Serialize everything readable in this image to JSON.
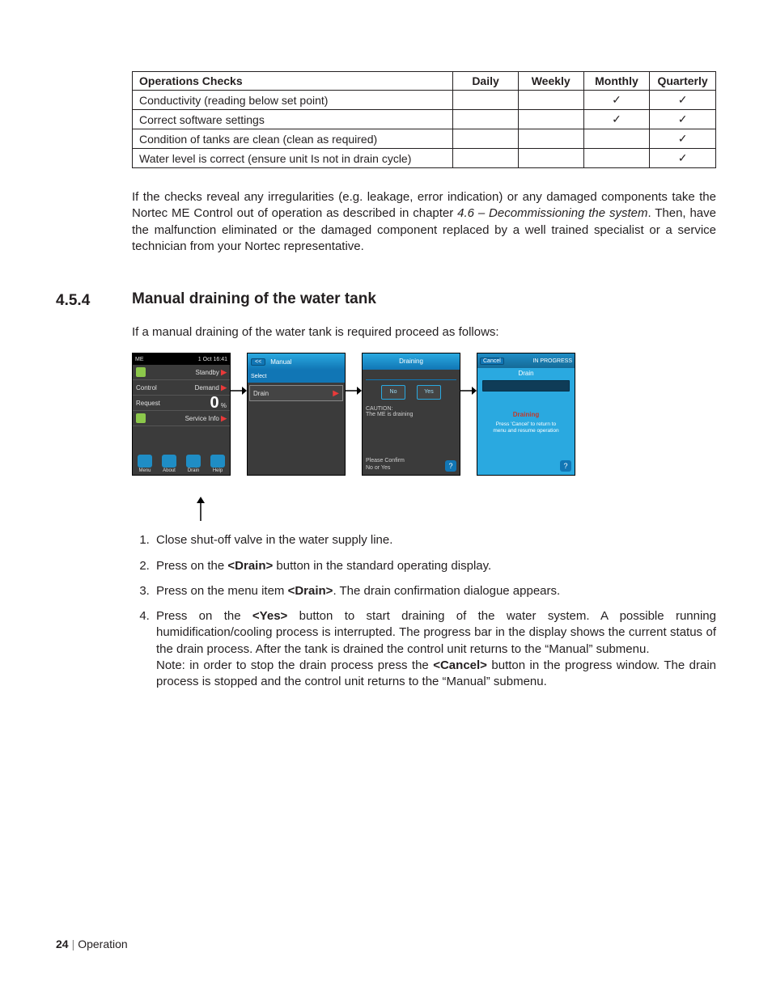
{
  "checks_table": {
    "headers": [
      "Operations Checks",
      "Daily",
      "Weekly",
      "Monthly",
      "Quarterly"
    ],
    "tick": "✓",
    "rows": [
      {
        "label": "Conductivity (reading below set point)",
        "daily": "",
        "weekly": "",
        "monthly": "tick",
        "quarterly": "tick"
      },
      {
        "label": "Correct software settings",
        "daily": "",
        "weekly": "",
        "monthly": "tick",
        "quarterly": "tick"
      },
      {
        "label": "Condition of tanks are clean (clean as required)",
        "daily": "",
        "weekly": "",
        "monthly": "",
        "quarterly": "tick"
      },
      {
        "label": "Water level is correct (ensure unit Is not in drain cycle)",
        "daily": "",
        "weekly": "",
        "monthly": "",
        "quarterly": "tick"
      }
    ]
  },
  "para_after_table": {
    "t1": "If the checks reveal any irregularities (e.g. leakage, error indication) or any damaged components take the Nortec ME Control out of operation as described in chapter ",
    "ref": "4.6 – Decommissioning the system",
    "t2": ". Then, have the malfunction eliminated or the damaged component replaced by a well trained specialist or a service technician from your Nortec representative."
  },
  "section": {
    "num": "4.5.4",
    "title": "Manual draining of the water tank",
    "intro": "If a manual draining of the water tank is required proceed as follows:"
  },
  "screens": {
    "s1": {
      "device": "ME",
      "datetime": "1 Oct 16:41",
      "rows": [
        {
          "left": "",
          "right": "Standby"
        },
        {
          "left": "Control",
          "right": "Demand"
        },
        {
          "left": "Request",
          "value": "0",
          "unit": "%"
        },
        {
          "left": "",
          "right": "Service Info"
        }
      ],
      "icons": [
        {
          "name": "menu-icon",
          "label": "Menu",
          "color": "#1f8dc5"
        },
        {
          "name": "about-icon",
          "label": "About",
          "color": "#1f8dc5"
        },
        {
          "name": "drain-icon",
          "label": "Drain",
          "color": "#1f8dc5"
        },
        {
          "name": "help-icon",
          "label": "Help",
          "color": "#1f8dc5"
        }
      ]
    },
    "s2": {
      "back": "<<",
      "title": "Manual",
      "selected": "Select",
      "item": "Drain"
    },
    "s3": {
      "title": "Draining",
      "no": "No",
      "yes": "Yes",
      "caution_h": "CAUTION:",
      "caution_t": "The ME is draining",
      "confirm_l1": "Please Confirm",
      "confirm_l2": "No or Yes",
      "help": "?"
    },
    "s4": {
      "cancel": "Cancel",
      "status": "IN PROGRESS",
      "subtitle": "Drain",
      "label": "Draining",
      "hint_l1": "Press 'Cancel' to return to",
      "hint_l2": "menu and resume operation",
      "help": "?"
    }
  },
  "steps": {
    "s1": "Close shut-off valve in the water supply line.",
    "s2a": "Press on the ",
    "s2b": "<Drain>",
    "s2c": " button in the standard operating display.",
    "s3a": "Press on the menu item ",
    "s3b": "<Drain>",
    "s3c": ". The drain confirmation dialogue appears.",
    "s4a": "Press on the ",
    "s4b": "<Yes>",
    "s4c": " button to start draining of the water system. A possible running humidification/cooling process is interrupted. The progress bar in the display shows the current status of the drain process. After the tank is drained the control unit returns to the “Manual” submenu.",
    "s4d": "Note: in order to stop the drain process press the ",
    "s4e": "<Cancel>",
    "s4f": " button in the progress window. The drain process is stopped and the control unit returns to the “Manual” submenu."
  },
  "footer": {
    "page": "24",
    "section": "Operation"
  }
}
